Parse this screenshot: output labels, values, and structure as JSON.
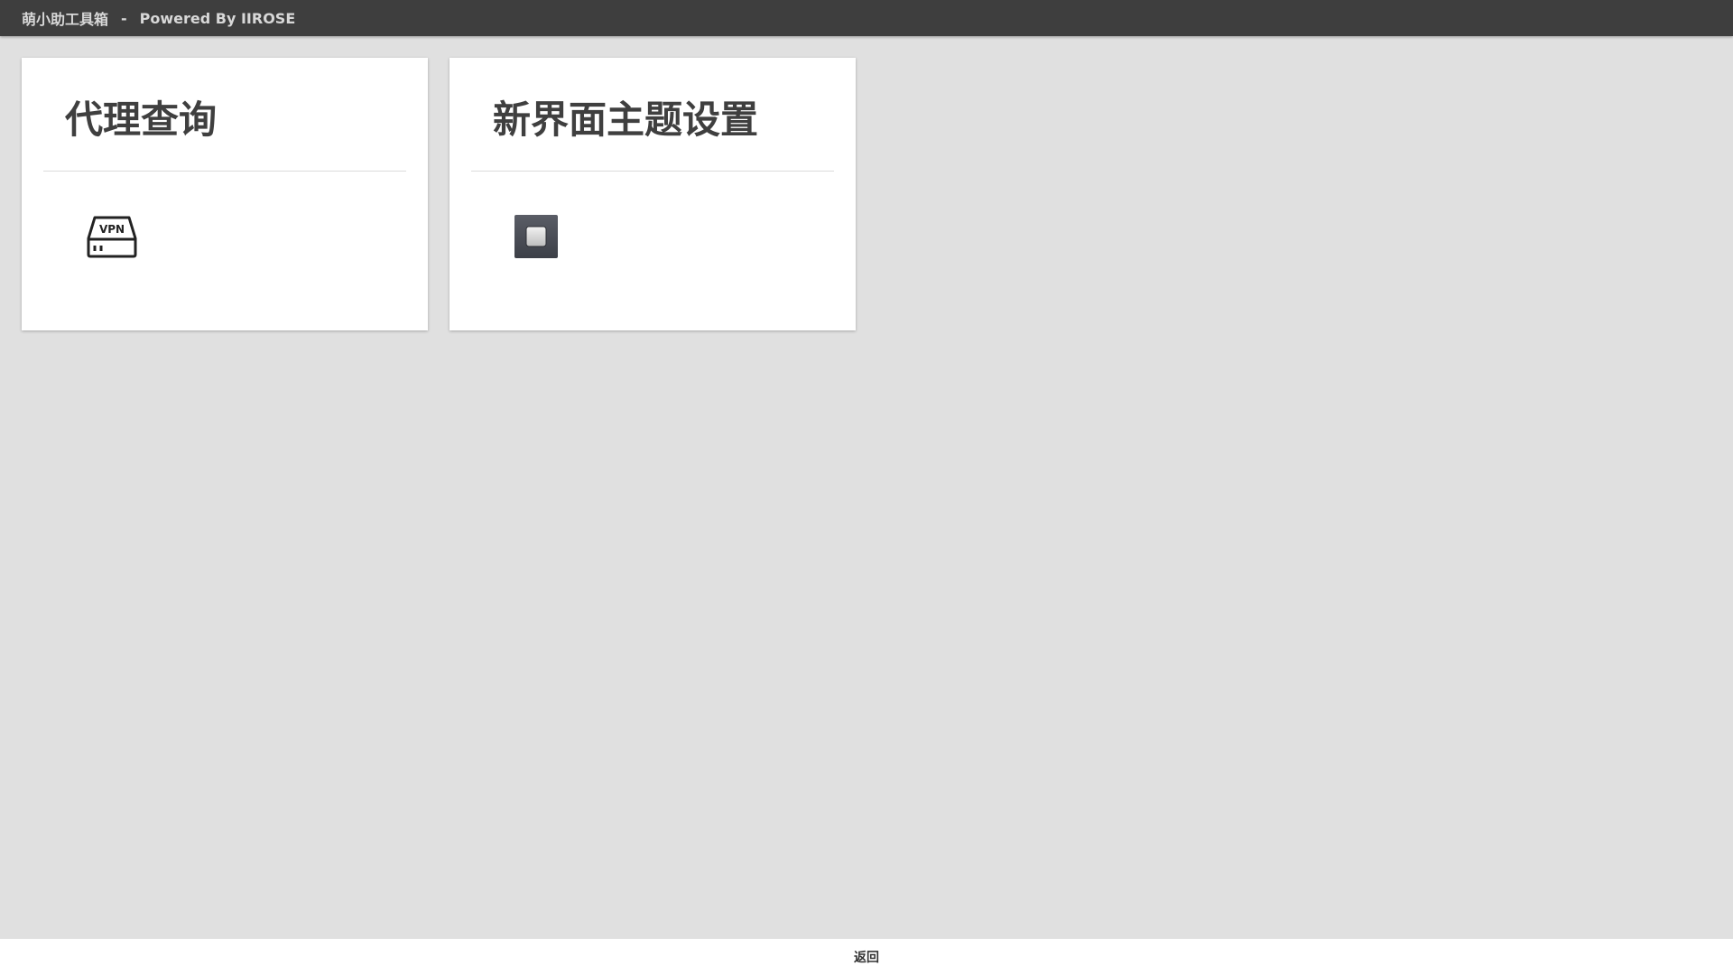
{
  "header": {
    "app_name": "萌小助工具箱",
    "separator": "-",
    "powered_by": "Powered By IIROSE"
  },
  "cards": [
    {
      "title": "代理查询",
      "icon": "vpn-icon",
      "icon_label": "VPN"
    },
    {
      "title": "新界面主题设置",
      "icon": "theme-icon"
    }
  ],
  "footer": {
    "back_label": "返回"
  },
  "colors": {
    "topbar_bg": "#3e3e3e",
    "page_bg": "#e0e0e0",
    "card_bg": "#ffffff",
    "title_text": "#3f3f3f",
    "theme_icon_bg": "#4a4d55"
  }
}
